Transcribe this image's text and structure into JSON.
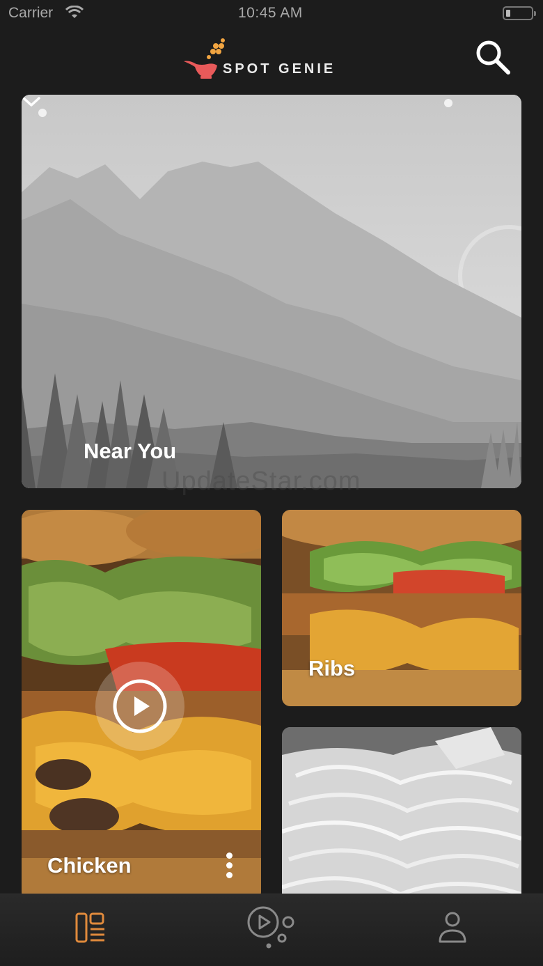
{
  "status_bar": {
    "carrier": "Carrier",
    "time": "10:45 AM",
    "wifi_icon": "wifi-icon",
    "battery_icon": "battery-icon"
  },
  "header": {
    "logo_text": "SPOT GENIE",
    "logo_icon": "genie-lamp-icon",
    "search_icon": "search-icon"
  },
  "hero": {
    "title": "Near You",
    "expand_icon": "chevron-down-icon"
  },
  "watermark": "UpdateStar.com",
  "cards": {
    "chicken": {
      "label": "Chicken",
      "play_icon": "play-icon",
      "more_icon": "more-vertical-icon"
    },
    "ribs": {
      "label": "Ribs"
    },
    "slaw": {
      "label": ""
    }
  },
  "tabbar": {
    "tabs": [
      {
        "name": "feed",
        "icon": "layout-grid-icon",
        "active": true
      },
      {
        "name": "discover",
        "icon": "play-bubbles-icon",
        "active": false
      },
      {
        "name": "profile",
        "icon": "user-icon",
        "active": false
      }
    ]
  },
  "colors": {
    "background": "#1c1c1c",
    "accent": "#e08a3c",
    "logo_lamp": "#e85a5a",
    "logo_dots": "#f2a541",
    "inactive_icon": "#8a8a8a"
  }
}
